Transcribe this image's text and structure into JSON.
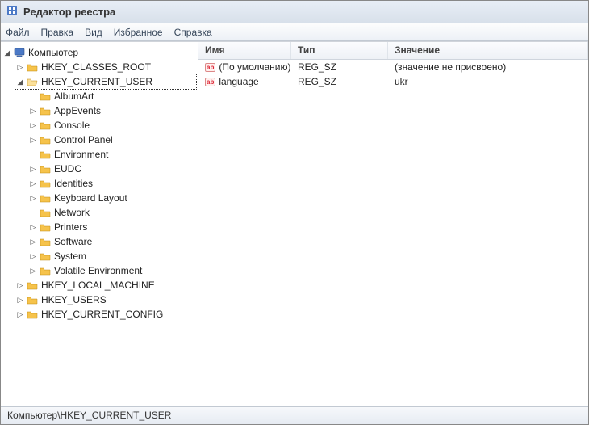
{
  "window": {
    "title": "Редактор реестра"
  },
  "menu": {
    "file": "Файл",
    "edit": "Правка",
    "view": "Вид",
    "favorites": "Избранное",
    "help": "Справка"
  },
  "tree": {
    "root": "Компьютер",
    "hives": {
      "classes_root": "HKEY_CLASSES_ROOT",
      "current_user": "HKEY_CURRENT_USER",
      "local_machine": "HKEY_LOCAL_MACHINE",
      "users": "HKEY_USERS",
      "current_config": "HKEY_CURRENT_CONFIG"
    },
    "hkcu_children": {
      "albumart": "AlbumArt",
      "appevents": "AppEvents",
      "console": "Console",
      "control_panel": "Control Panel",
      "environment": "Environment",
      "eudc": "EUDC",
      "identities": "Identities",
      "keyboard_layout": "Keyboard Layout",
      "network": "Network",
      "printers": "Printers",
      "software": "Software",
      "system": "System",
      "volatile_environment": "Volatile Environment"
    }
  },
  "list": {
    "columns": {
      "name": "Имя",
      "type": "Тип",
      "value": "Значение"
    },
    "rows": [
      {
        "name": "(По умолчанию)",
        "type": "REG_SZ",
        "value": "(значение не присвоено)"
      },
      {
        "name": "language",
        "type": "REG_SZ",
        "value": "ukr"
      }
    ]
  },
  "status": {
    "path": "Компьютер\\HKEY_CURRENT_USER"
  },
  "icons": {
    "root_expander_expanded": "◢",
    "expander_collapsed": "▷",
    "expander_expanded": "◢",
    "reg_sz_badge": "ab"
  }
}
